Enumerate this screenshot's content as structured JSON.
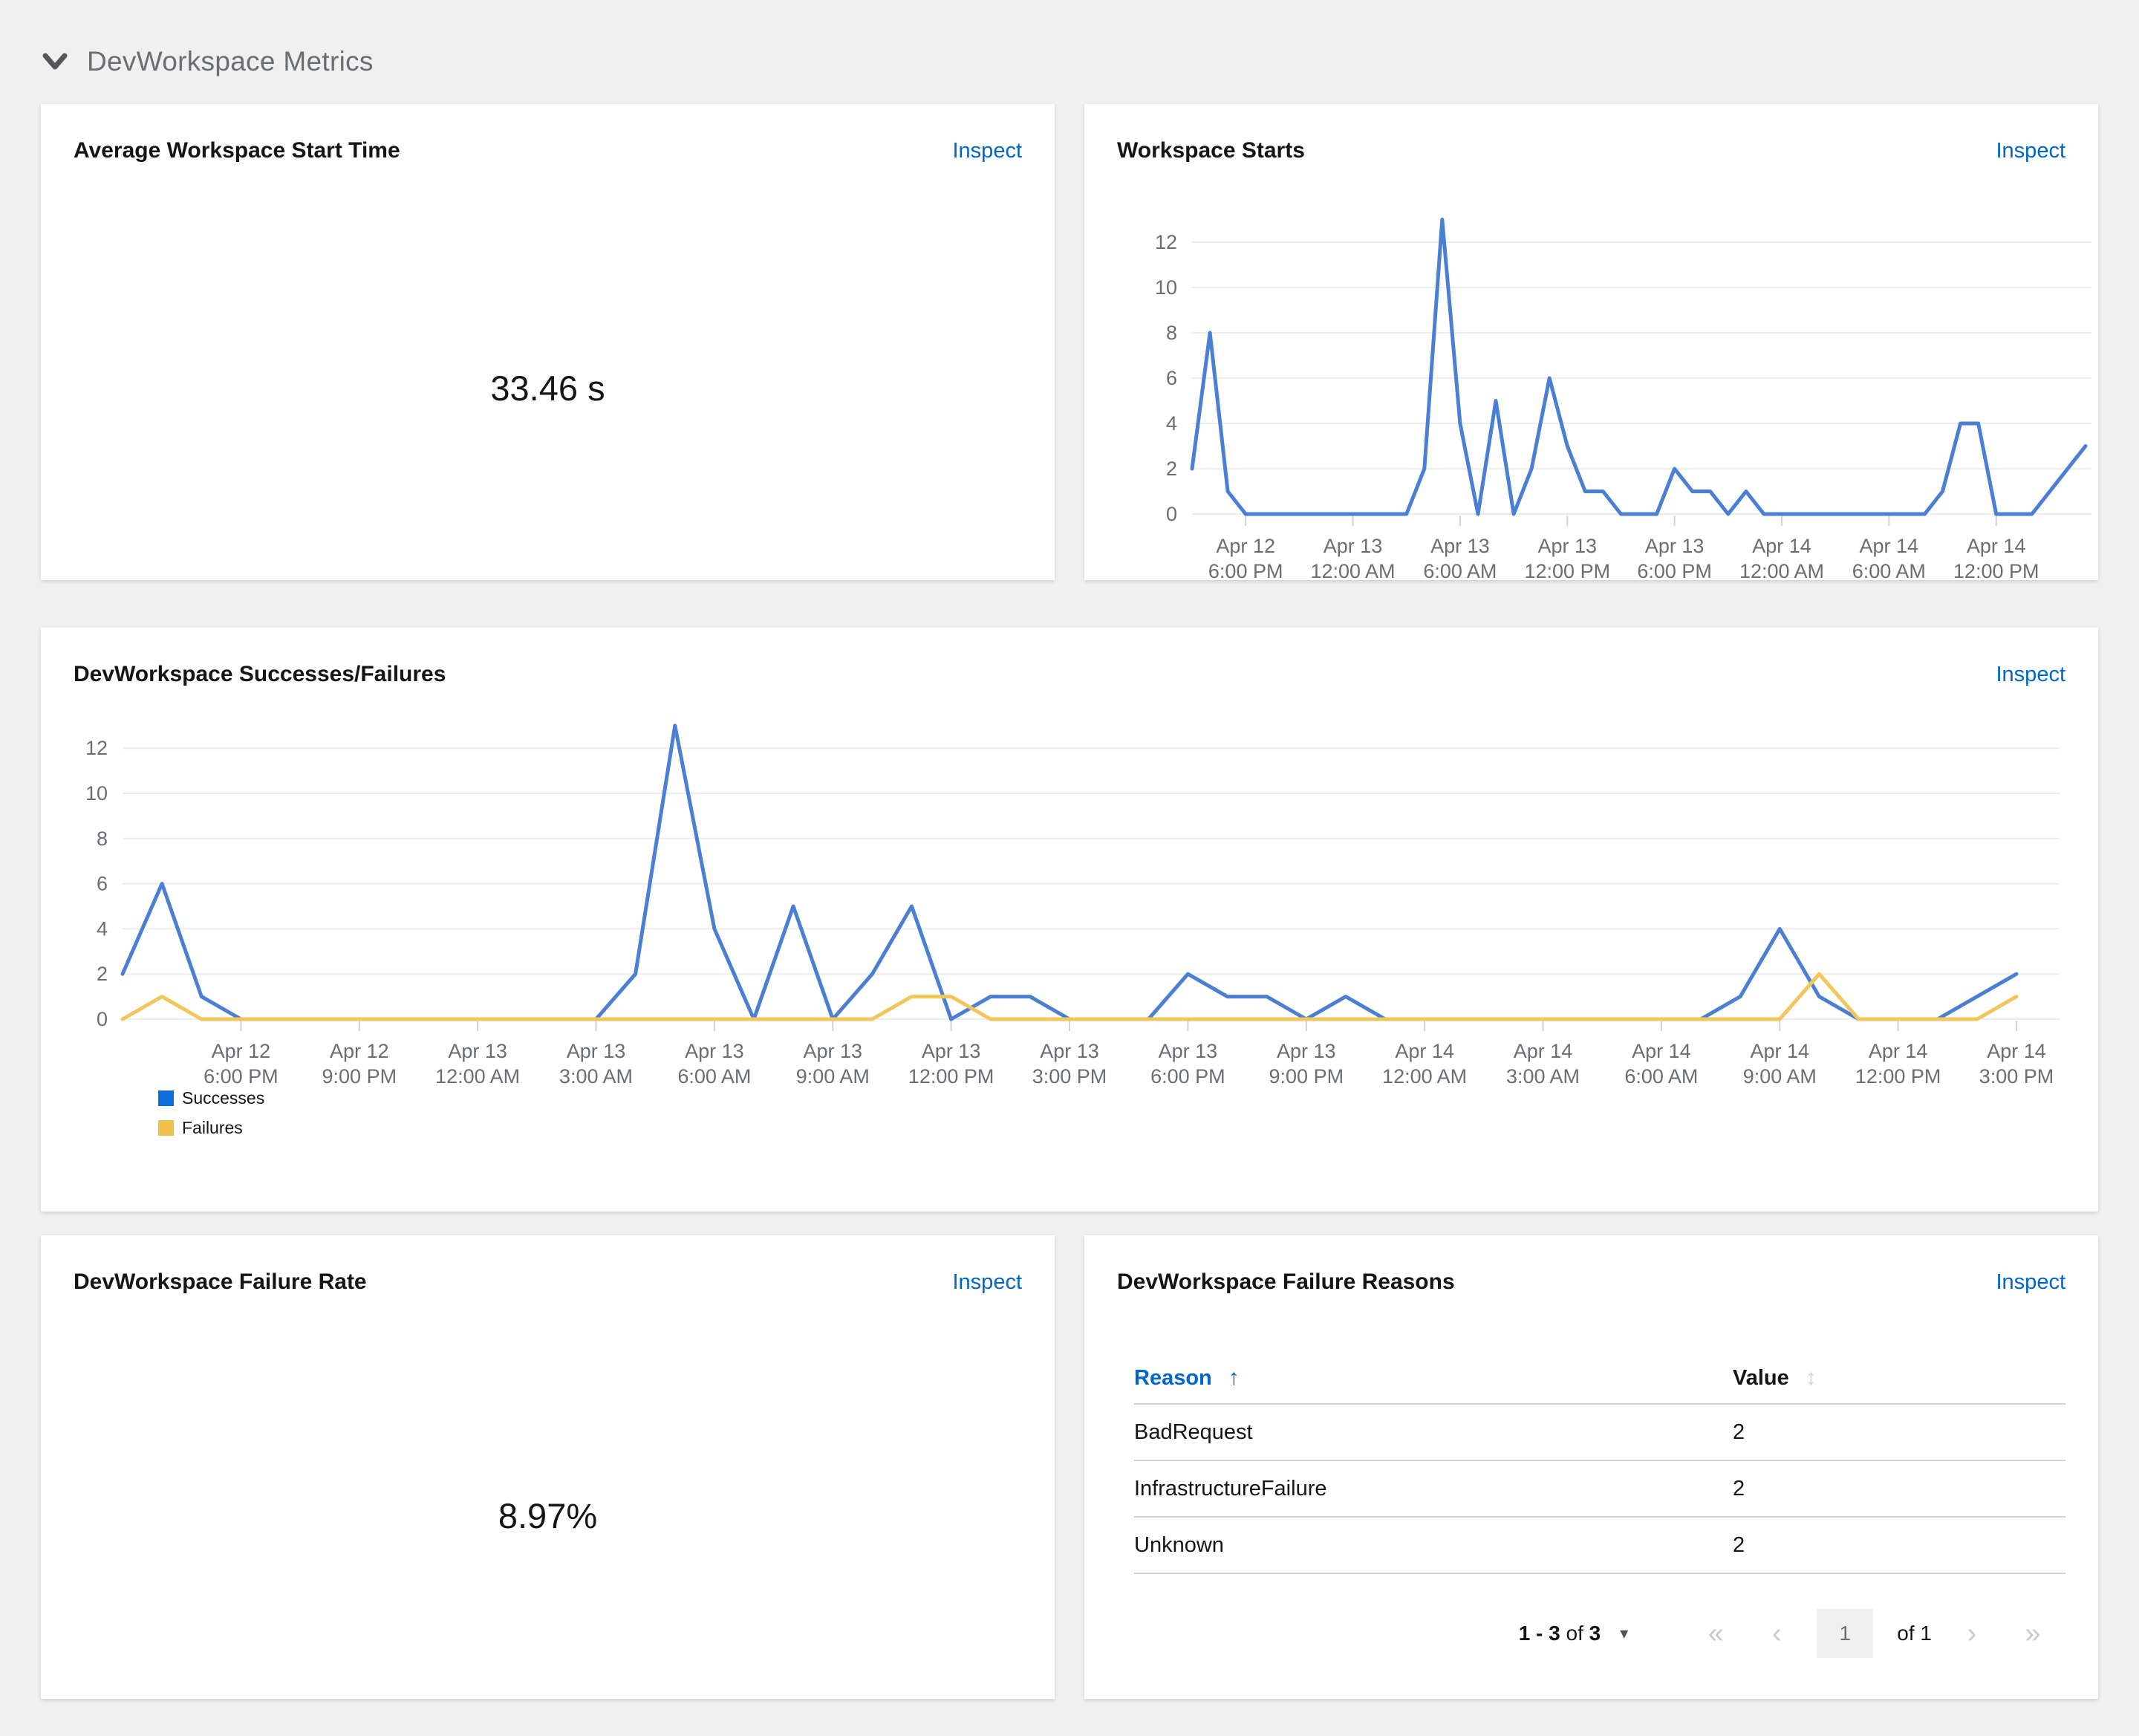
{
  "section": {
    "title": "DevWorkspace Metrics"
  },
  "colors": {
    "page_background": "#f0f0f0",
    "card_background": "#ffffff",
    "link_blue": "#0066cc",
    "successes_line": "#4a7fd4",
    "successes_swatch": "#0d6edb",
    "failures_line": "#f1c65c",
    "failures_swatch": "#f2c14a",
    "gridline": "#ededed",
    "axis_text": "#6a6e73"
  },
  "cards": {
    "avg_start_time": {
      "title": "Average Workspace Start Time",
      "action": "Inspect",
      "value": "33.46 s"
    },
    "workspace_starts": {
      "title": "Workspace Starts",
      "action": "Inspect"
    },
    "successes_failures": {
      "title": "DevWorkspace Successes/Failures",
      "action": "Inspect"
    },
    "failure_rate": {
      "title": "DevWorkspace Failure Rate",
      "action": "Inspect",
      "value": "8.97%"
    },
    "failure_reasons": {
      "title": "DevWorkspace Failure Reasons",
      "action": "Inspect",
      "table": {
        "columns": [
          "Reason",
          "Value"
        ],
        "sorted_column": "Reason",
        "rows": [
          {
            "reason": "BadRequest",
            "value": "2"
          },
          {
            "reason": "InfrastructureFailure",
            "value": "2"
          },
          {
            "reason": "Unknown",
            "value": "2"
          }
        ]
      },
      "pagination": {
        "items_range": "1 - 3",
        "of_word": "of",
        "items_total": "3",
        "current_page": "1",
        "total_pages": "1"
      }
    }
  },
  "chart_data": [
    {
      "type": "line",
      "title": "Workspace Starts",
      "x_start": "Apr 12 3:00 PM",
      "x_interval_hours": 1,
      "ylim": [
        0,
        13
      ],
      "yticks": [
        0,
        2,
        4,
        6,
        8,
        10,
        12
      ],
      "grid": true,
      "legend_position": "none",
      "series": [
        {
          "name": "Starts",
          "color": "#4a7fd4",
          "values": [
            2,
            8,
            1,
            0,
            0,
            0,
            0,
            0,
            0,
            0,
            0,
            0,
            0,
            2,
            13,
            4,
            0,
            5,
            0,
            2,
            6,
            3,
            1,
            1,
            0,
            0,
            0,
            2,
            1,
            1,
            0,
            1,
            0,
            0,
            0,
            0,
            0,
            0,
            0,
            0,
            0,
            0,
            1,
            4,
            4,
            0,
            0,
            0,
            1,
            2,
            3
          ]
        }
      ],
      "xticks": [
        {
          "index": 3,
          "date": "Apr 12",
          "time": "6:00 PM"
        },
        {
          "index": 9,
          "date": "Apr 13",
          "time": "12:00 AM"
        },
        {
          "index": 15,
          "date": "Apr 13",
          "time": "6:00 AM"
        },
        {
          "index": 21,
          "date": "Apr 13",
          "time": "12:00 PM"
        },
        {
          "index": 27,
          "date": "Apr 13",
          "time": "6:00 PM"
        },
        {
          "index": 33,
          "date": "Apr 14",
          "time": "12:00 AM"
        },
        {
          "index": 39,
          "date": "Apr 14",
          "time": "6:00 AM"
        },
        {
          "index": 45,
          "date": "Apr 14",
          "time": "12:00 PM"
        }
      ]
    },
    {
      "type": "line",
      "title": "DevWorkspace Successes/Failures",
      "x_start": "Apr 12 3:00 PM",
      "x_interval_hours": 1,
      "ylim": [
        0,
        13
      ],
      "yticks": [
        0,
        2,
        4,
        6,
        8,
        10,
        12
      ],
      "grid": true,
      "legend_position": "bottom-left",
      "legend": [
        {
          "label": "Successes",
          "swatch": "#0d6edb"
        },
        {
          "label": "Failures",
          "swatch": "#f2c14a"
        }
      ],
      "series": [
        {
          "name": "Successes",
          "color": "#4a7fd4",
          "values": [
            2,
            6,
            1,
            0,
            0,
            0,
            0,
            0,
            0,
            0,
            0,
            0,
            0,
            2,
            13,
            4,
            0,
            5,
            0,
            2,
            5,
            0,
            1,
            1,
            0,
            0,
            0,
            2,
            1,
            1,
            0,
            1,
            0,
            0,
            0,
            0,
            0,
            0,
            0,
            0,
            0,
            1,
            4,
            1,
            0,
            0,
            0,
            1,
            2
          ]
        },
        {
          "name": "Failures",
          "color": "#f1c65c",
          "values": [
            0,
            1,
            0,
            0,
            0,
            0,
            0,
            0,
            0,
            0,
            0,
            0,
            0,
            0,
            0,
            0,
            0,
            0,
            0,
            0,
            1,
            1,
            0,
            0,
            0,
            0,
            0,
            0,
            0,
            0,
            0,
            0,
            0,
            0,
            0,
            0,
            0,
            0,
            0,
            0,
            0,
            0,
            0,
            2,
            0,
            0,
            0,
            0,
            1
          ]
        }
      ],
      "xticks": [
        {
          "index": 3,
          "date": "Apr 12",
          "time": "6:00 PM"
        },
        {
          "index": 6,
          "date": "Apr 12",
          "time": "9:00 PM"
        },
        {
          "index": 9,
          "date": "Apr 13",
          "time": "12:00 AM"
        },
        {
          "index": 12,
          "date": "Apr 13",
          "time": "3:00 AM"
        },
        {
          "index": 15,
          "date": "Apr 13",
          "time": "6:00 AM"
        },
        {
          "index": 18,
          "date": "Apr 13",
          "time": "9:00 AM"
        },
        {
          "index": 21,
          "date": "Apr 13",
          "time": "12:00 PM"
        },
        {
          "index": 24,
          "date": "Apr 13",
          "time": "3:00 PM"
        },
        {
          "index": 27,
          "date": "Apr 13",
          "time": "6:00 PM"
        },
        {
          "index": 30,
          "date": "Apr 13",
          "time": "9:00 PM"
        },
        {
          "index": 33,
          "date": "Apr 14",
          "time": "12:00 AM"
        },
        {
          "index": 36,
          "date": "Apr 14",
          "time": "3:00 AM"
        },
        {
          "index": 39,
          "date": "Apr 14",
          "time": "6:00 AM"
        },
        {
          "index": 42,
          "date": "Apr 14",
          "time": "9:00 AM"
        },
        {
          "index": 45,
          "date": "Apr 14",
          "time": "12:00 PM"
        },
        {
          "index": 48,
          "date": "Apr 14",
          "time": "3:00 PM"
        }
      ]
    }
  ]
}
